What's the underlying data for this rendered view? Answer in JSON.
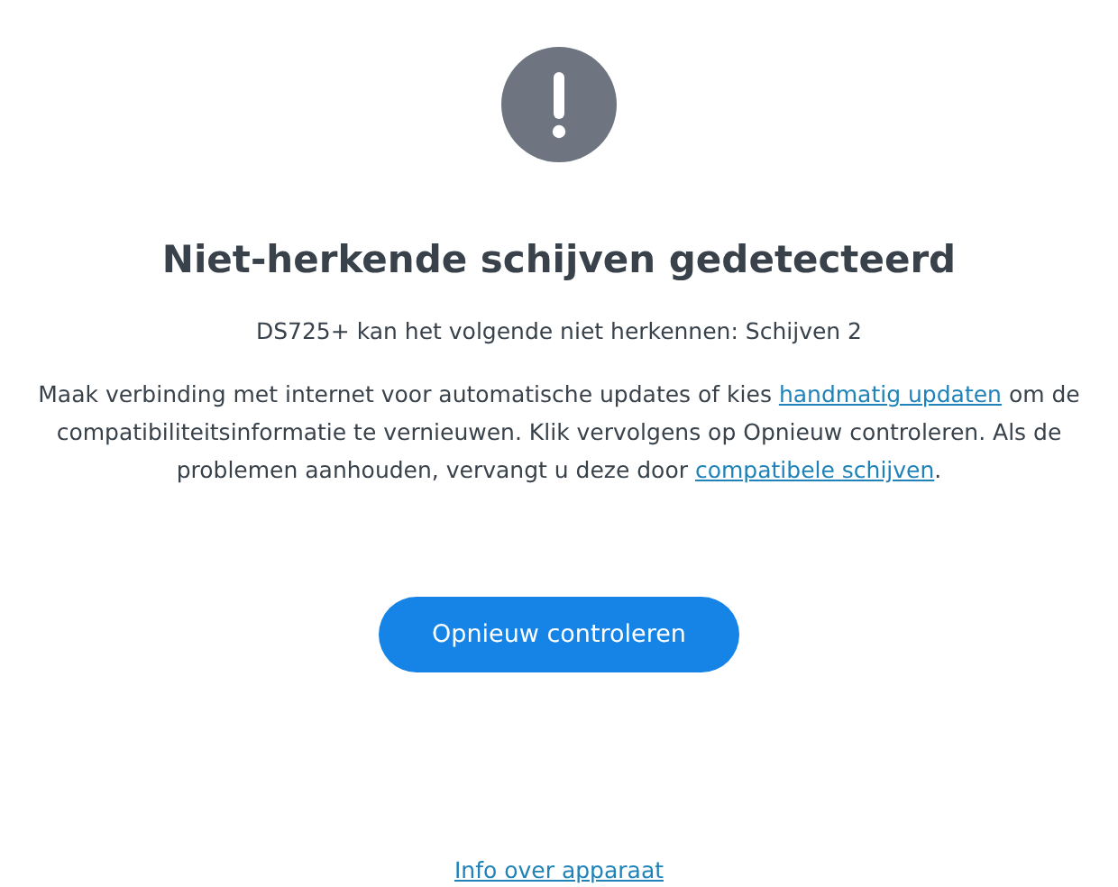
{
  "title": "Niet-herkende schijven gedetecteerd",
  "subtitle": "DS725+ kan het volgende niet herkennen: Schijven 2",
  "message": [
    {
      "kind": "text",
      "text": "Maak verbinding met internet voor automatische updates of kies "
    },
    {
      "kind": "link",
      "text": "handmatig updaten"
    },
    {
      "kind": "text",
      "text": " om de compatibiliteitsinformatie te vernieuwen. Klik vervolgens op Opnieuw controleren. Als de problemen aanhouden, vervangt u deze door "
    },
    {
      "kind": "link",
      "text": "compatibele schijven"
    },
    {
      "kind": "text",
      "text": "."
    }
  ],
  "button": "Opnieuw controleren",
  "footer_link": "Info over apparaat"
}
